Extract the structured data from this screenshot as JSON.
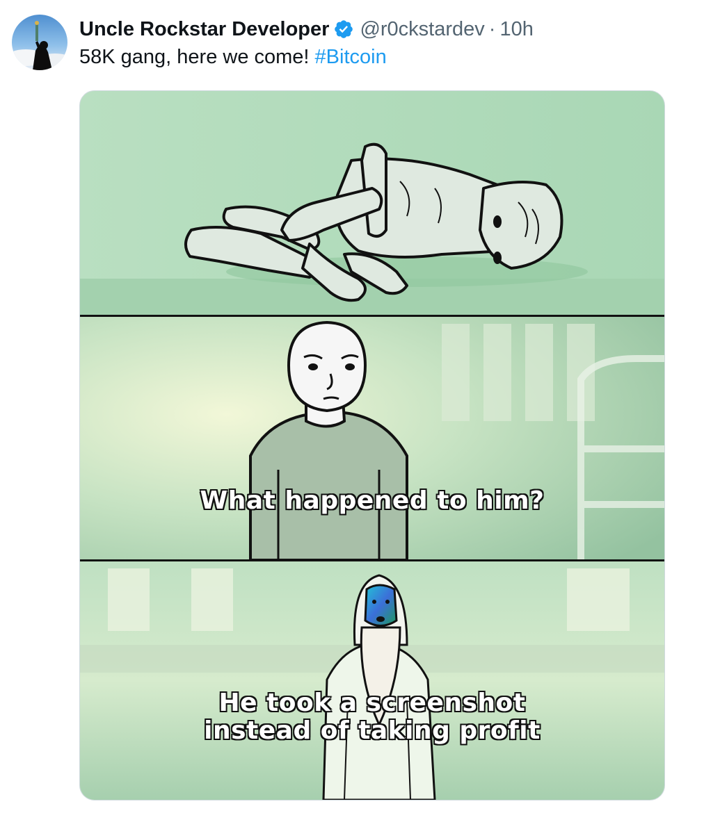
{
  "tweet": {
    "author": {
      "display_name": "Uncle Rockstar Developer",
      "verified": true,
      "handle": "@r0ckstardev",
      "separator": "·",
      "time": "10h",
      "avatar_icon": "statue-of-liberty-avatar-icon"
    },
    "text": {
      "body": "58K gang, here we come! ",
      "hashtag": "#Bitcoin"
    },
    "colors": {
      "link": "#1d9bf0",
      "verified": "#1d9bf0",
      "secondary_text": "#536471",
      "primary_text": "#0f1419",
      "panel_green": "#cde7d2"
    },
    "media": {
      "panels": [
        {
          "scene": "emaciated-figure-lying-on-floor",
          "caption": ""
        },
        {
          "scene": "wojak-standing-in-hospital",
          "caption": "What happened to him?"
        },
        {
          "scene": "bearded-wise-man-with-glowing-face",
          "caption_lines": [
            "He took a screenshot",
            "instead of taking profit"
          ]
        }
      ]
    }
  }
}
